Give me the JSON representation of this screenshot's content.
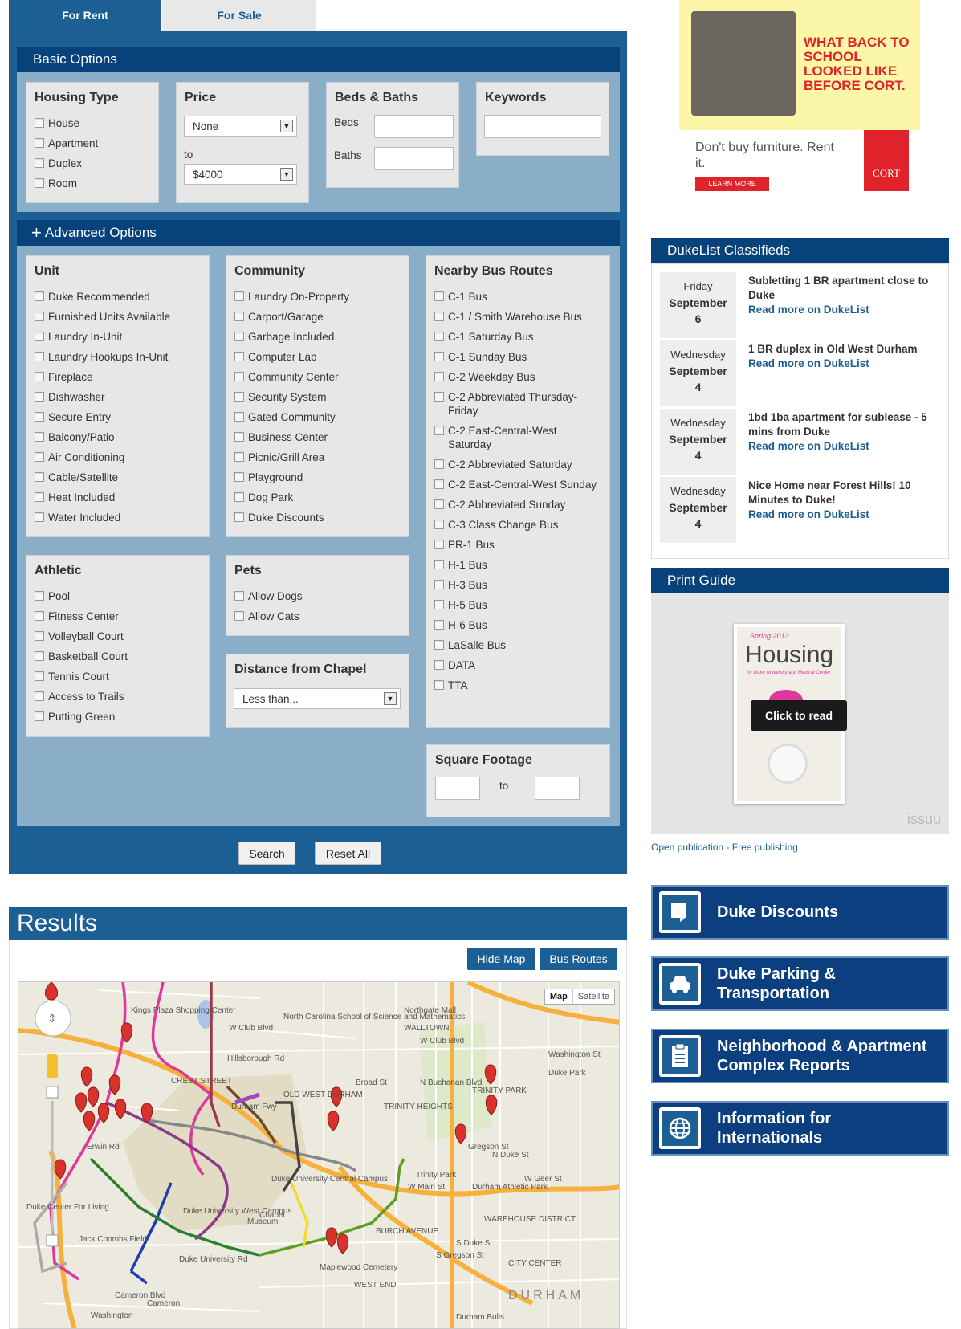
{
  "tabs": {
    "rent": "For Rent",
    "sale": "For Sale"
  },
  "basic": {
    "title": "Basic Options",
    "housing": {
      "title": "Housing Type",
      "items": [
        "House",
        "Apartment",
        "Duplex",
        "Room"
      ]
    },
    "price": {
      "title": "Price",
      "min": "None",
      "to": "to",
      "max": "$4000"
    },
    "beds": {
      "title": "Beds & Baths",
      "beds": "Beds",
      "baths": "Baths"
    },
    "keywords": {
      "title": "Keywords"
    }
  },
  "advanced": {
    "title": "Advanced Options",
    "unit": {
      "title": "Unit",
      "items": [
        "Duke Recommended",
        "Furnished Units Available",
        "Laundry In-Unit",
        "Laundry Hookups In-Unit",
        "Fireplace",
        "Dishwasher",
        "Secure Entry",
        "Balcony/Patio",
        "Air Conditioning",
        "Cable/Satellite",
        "Heat Included",
        "Water Included"
      ]
    },
    "community": {
      "title": "Community",
      "items": [
        "Laundry On-Property",
        "Carport/Garage",
        "Garbage Included",
        "Computer Lab",
        "Community Center",
        "Security System",
        "Gated Community",
        "Business Center",
        "Picnic/Grill Area",
        "Playground",
        "Dog Park",
        "Duke Discounts"
      ]
    },
    "bus": {
      "title": "Nearby Bus Routes",
      "items": [
        "C-1 Bus",
        "C-1 / Smith Warehouse Bus",
        "C-1 Saturday Bus",
        "C-1 Sunday Bus",
        "C-2 Weekday Bus",
        "C-2 Abbreviated Thursday-Friday",
        "C-2 East-Central-West Saturday",
        "C-2 Abbreviated Saturday",
        "C-2 East-Central-West Sunday",
        "C-2 Abbreviated Sunday",
        "C-3 Class Change Bus",
        "PR-1 Bus",
        "H-1 Bus",
        "H-3 Bus",
        "H-5 Bus",
        "H-6 Bus",
        "LaSalle Bus",
        "DATA",
        "TTA"
      ]
    },
    "athletic": {
      "title": "Athletic",
      "items": [
        "Pool",
        "Fitness Center",
        "Volleyball Court",
        "Basketball Court",
        "Tennis Court",
        "Access to Trails",
        "Putting Green"
      ]
    },
    "pets": {
      "title": "Pets",
      "items": [
        "Allow Dogs",
        "Allow Cats"
      ]
    },
    "distance": {
      "title": "Distance from Chapel",
      "value": "Less than..."
    },
    "sqft": {
      "title": "Square Footage",
      "to": "to"
    }
  },
  "actions": {
    "search": "Search",
    "reset": "Reset All"
  },
  "results": {
    "title": "Results",
    "hide_map": "Hide Map",
    "bus_routes": "Bus Routes"
  },
  "map": {
    "type_map": "Map",
    "type_sat": "Satellite",
    "labels": [
      "Kings Plaza Shopping Center",
      "W Club Blvd",
      "North Carolina School of Science and Mathematics",
      "Northgate Mall",
      "WALLTOWN",
      "W Club Blvd",
      "Hillsborough Rd",
      "CREST STREET",
      "OLD WEST DURHAM",
      "Durham Fwy",
      "TRINITY HEIGHTS",
      "TRINITY PARK",
      "N Buchanan Blvd",
      "Broad St",
      "Duke University Central Campus",
      "Duke University West Campus",
      "Duke Center For Living",
      "Erwin Rd",
      "Jack Coombs Field",
      "Trinity Park",
      "Duke Park",
      "Durham Athletic Park",
      "W Geer St",
      "WAREHOUSE DISTRICT",
      "BURCH AVENUE",
      "W Main St",
      "Maplewood Cemetery",
      "CITY CENTER",
      "WEST END",
      "DURHAM",
      "Duke University Rd",
      "Cameron Blvd",
      "Washington",
      "Durham Bulls",
      "Gregson St",
      "N Duke St",
      "Washington St",
      "S Duke St",
      "S Gregson St",
      "Museum",
      "Chapel",
      "Cameron"
    ]
  },
  "ad": {
    "headline": "WHAT BACK TO SCHOOL LOOKED LIKE BEFORE CORT.",
    "tagline": "Don't buy furniture. Rent it.",
    "cta": "LEARN MORE",
    "brand": "CORT"
  },
  "classifieds": {
    "title": "DukeList Classifieds",
    "read_more": "Read more on DukeList",
    "items": [
      {
        "day": "Friday",
        "month": "September",
        "date": "6",
        "title": "Subletting 1 BR apartment close to Duke"
      },
      {
        "day": "Wednesday",
        "month": "September",
        "date": "4",
        "title": "1 BR duplex in Old West Durham"
      },
      {
        "day": "Wednesday",
        "month": "September",
        "date": "4",
        "title": "1bd 1ba apartment for sublease - 5 mins from Duke"
      },
      {
        "day": "Wednesday",
        "month": "September",
        "date": "4",
        "title": "Nice Home near Forest Hills! 10 Minutes to Duke!"
      }
    ]
  },
  "print_guide": {
    "title": "Print Guide",
    "cover_season": "Spring 2013",
    "cover_title": "Housing",
    "cover_sub": "for Duke University and Medical Center",
    "click": "Click to read",
    "issuu": "issuu",
    "open": "Open publication",
    "free": " - Free publishing"
  },
  "side_buttons": [
    {
      "label": "Duke Discounts"
    },
    {
      "label": "Duke Parking & Transportation"
    },
    {
      "label": "Neighborhood & Apartment Complex Reports"
    },
    {
      "label": "Information for Internationals"
    }
  ],
  "colors": {
    "primary": "#1b5f94",
    "dark": "#08427a",
    "panel": "#8aaec8",
    "box": "#e7e7e7"
  }
}
